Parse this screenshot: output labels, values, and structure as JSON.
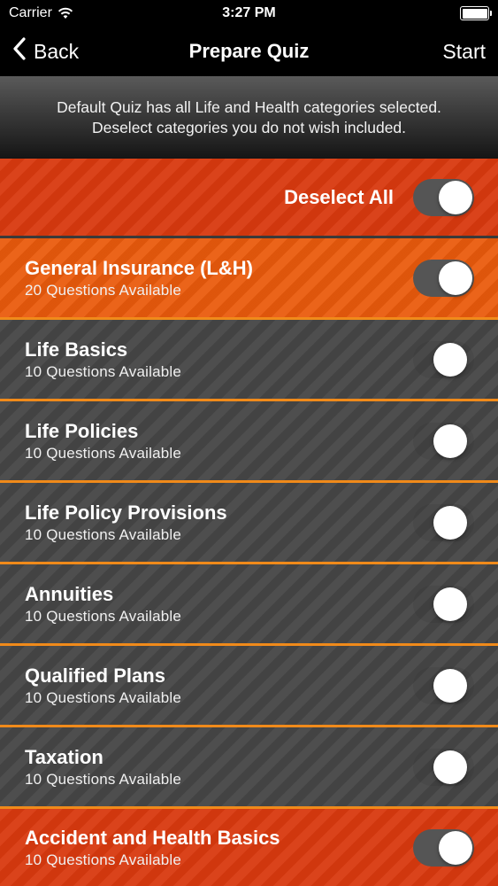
{
  "status_bar": {
    "carrier": "Carrier",
    "time": "3:27 PM"
  },
  "nav": {
    "back_label": "Back",
    "title": "Prepare Quiz",
    "start_label": "Start"
  },
  "banner": {
    "line1": "Default Quiz has all Life and Health categories selected.",
    "line2": "Deselect categories you do not wish included."
  },
  "deselect_all": {
    "label": "Deselect All",
    "on": true
  },
  "categories": [
    {
      "title": "General Insurance (L&H)",
      "subtitle": "20 Questions Available",
      "on": true
    },
    {
      "title": "Life Basics",
      "subtitle": "10 Questions Available",
      "on": false
    },
    {
      "title": "Life Policies",
      "subtitle": "10 Questions Available",
      "on": false
    },
    {
      "title": "Life Policy Provisions",
      "subtitle": "10 Questions Available",
      "on": false
    },
    {
      "title": "Annuities",
      "subtitle": "10 Questions Available",
      "on": false
    },
    {
      "title": "Qualified Plans",
      "subtitle": "10 Questions Available",
      "on": false
    },
    {
      "title": "Taxation",
      "subtitle": "10 Questions Available",
      "on": false
    },
    {
      "title": "Accident and Health Basics",
      "subtitle": "10 Questions Available",
      "on": true
    }
  ]
}
